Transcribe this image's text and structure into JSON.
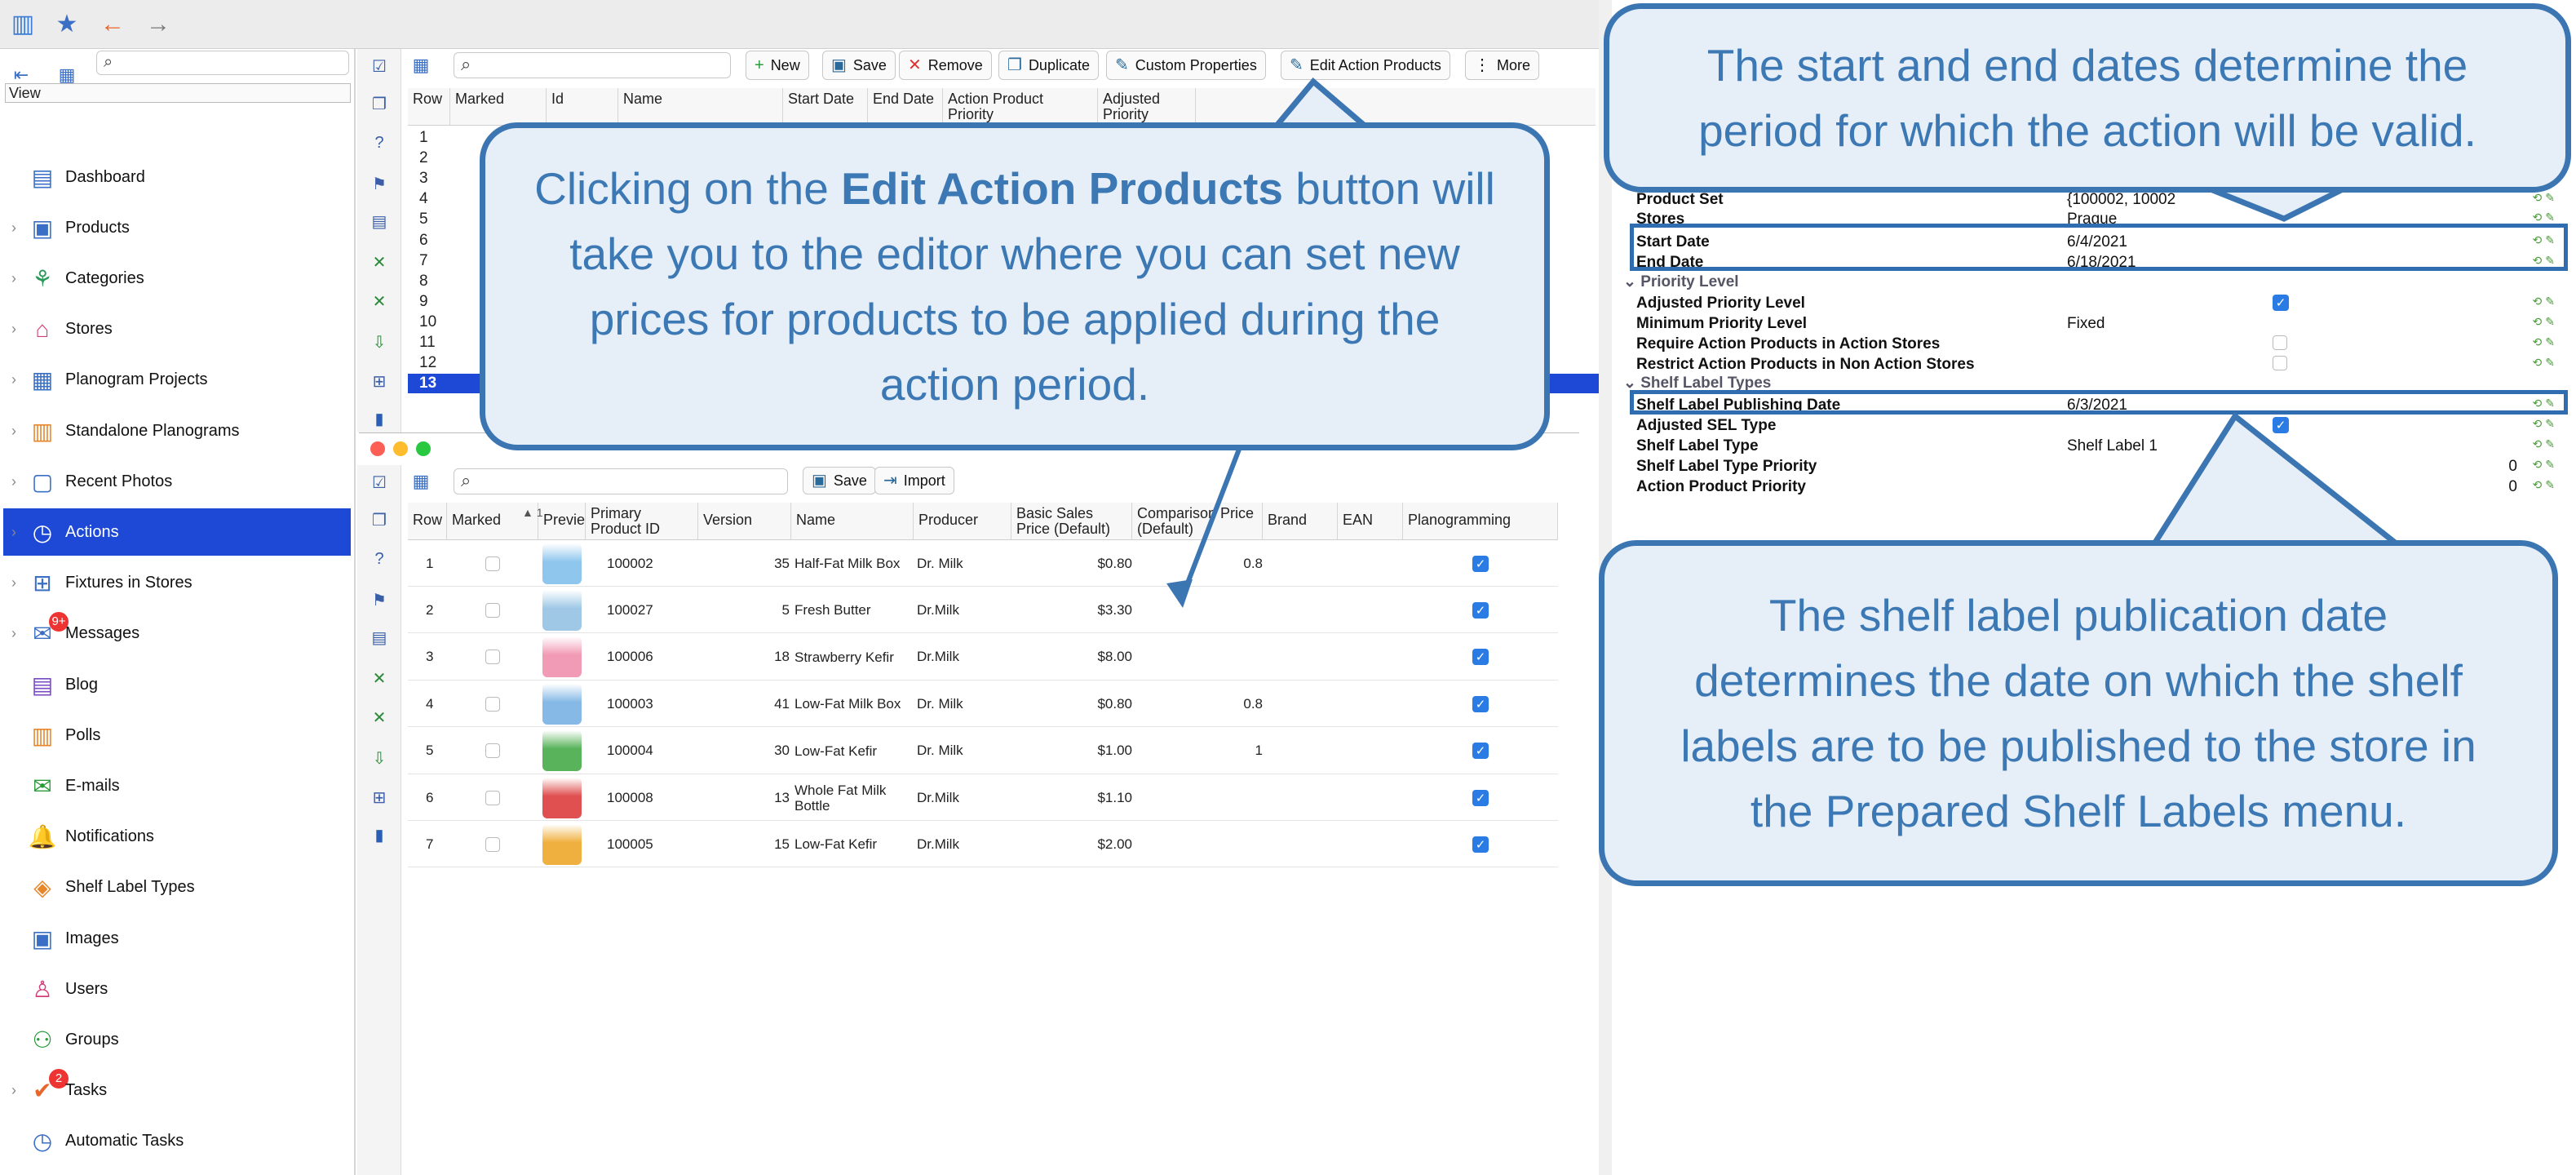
{
  "nav": {
    "view_label": "View",
    "items": [
      {
        "label": "Dashboard",
        "icon": "dashboard-icon"
      },
      {
        "label": "Products",
        "icon": "products-icon"
      },
      {
        "label": "Categories",
        "icon": "categories-icon"
      },
      {
        "label": "Stores",
        "icon": "stores-icon"
      },
      {
        "label": "Planogram Projects",
        "icon": "planogram-projects-icon"
      },
      {
        "label": "Standalone Planograms",
        "icon": "standalone-planograms-icon"
      },
      {
        "label": "Recent Photos",
        "icon": "recent-photos-icon"
      },
      {
        "label": "Actions",
        "icon": "actions-icon"
      },
      {
        "label": "Fixtures in Stores",
        "icon": "fixtures-icon"
      },
      {
        "label": "Messages",
        "icon": "messages-icon",
        "badge": "9+"
      },
      {
        "label": "Blog",
        "icon": "blog-icon"
      },
      {
        "label": "Polls",
        "icon": "polls-icon"
      },
      {
        "label": "E-mails",
        "icon": "email-icon"
      },
      {
        "label": "Notifications",
        "icon": "notifications-icon"
      },
      {
        "label": "Shelf Label Types",
        "icon": "shelf-label-types-icon"
      },
      {
        "label": "Images",
        "icon": "images-icon"
      },
      {
        "label": "Users",
        "icon": "users-icon"
      },
      {
        "label": "Groups",
        "icon": "groups-icon"
      },
      {
        "label": "Tasks",
        "icon": "tasks-icon",
        "badge": "2"
      },
      {
        "label": "Automatic Tasks",
        "icon": "automatic-tasks-icon"
      }
    ]
  },
  "toolbar": {
    "new": "New",
    "save": "Save",
    "remove": "Remove",
    "duplicate": "Duplicate",
    "custom_properties": "Custom Properties",
    "edit_action_products": "Edit Action Products",
    "more": "More"
  },
  "actions_grid": {
    "headers": [
      "Row",
      "Marked",
      "Id",
      "Name",
      "Start Date",
      "End Date",
      "Action Product Priority",
      "Adjusted Priority"
    ],
    "rows": [
      "1",
      "2",
      "3",
      "4",
      "5",
      "6",
      "7",
      "8",
      "9",
      "10",
      "11",
      "12",
      "13"
    ]
  },
  "products_window": {
    "save": "Save",
    "import": "Import",
    "sort_indicator": "1",
    "headers": [
      "Row",
      "Marked",
      "Preview",
      "Primary Product ID",
      "Version",
      "Name",
      "Producer",
      "Basic Sales Price (Default)",
      "Comparison Price (Default)",
      "Brand",
      "EAN",
      "Planogramming"
    ],
    "rows": [
      {
        "row": "1",
        "id": "100002",
        "version": "35",
        "name": "Half-Fat Milk Box",
        "producer": "Dr. Milk",
        "price": "$0.80",
        "comparison": "0.8",
        "planogramming": true,
        "color": "#8fc6ee"
      },
      {
        "row": "2",
        "id": "100027",
        "version": "5",
        "name": "Fresh Butter",
        "producer": "Dr.Milk",
        "price": "$3.30",
        "comparison": "",
        "planogramming": true,
        "color": "#9fc8e6"
      },
      {
        "row": "3",
        "id": "100006",
        "version": "18",
        "name": "Strawberry Kefir",
        "producer": "Dr.Milk",
        "price": "$8.00",
        "comparison": "",
        "planogramming": true,
        "color": "#f29bb6"
      },
      {
        "row": "4",
        "id": "100003",
        "version": "41",
        "name": "Low-Fat Milk Box",
        "producer": "Dr. Milk",
        "price": "$0.80",
        "comparison": "0.8",
        "planogramming": true,
        "color": "#86b9e6"
      },
      {
        "row": "5",
        "id": "100004",
        "version": "30",
        "name": "Low-Fat Kefir",
        "producer": "Dr. Milk",
        "price": "$1.00",
        "comparison": "1",
        "planogramming": true,
        "color": "#58b35a"
      },
      {
        "row": "6",
        "id": "100008",
        "version": "13",
        "name": "Whole Fat Milk Bottle",
        "producer": "Dr.Milk",
        "price": "$1.10",
        "comparison": "",
        "planogramming": true,
        "color": "#e05050"
      },
      {
        "row": "7",
        "id": "100005",
        "version": "15",
        "name": "Low-Fat Kefir",
        "producer": "Dr.Milk",
        "price": "$2.00",
        "comparison": "",
        "planogramming": true,
        "color": "#f0b040"
      }
    ]
  },
  "properties": {
    "product_set": {
      "label": "Product Set",
      "value": "{100002, 10002"
    },
    "stores": {
      "label": "Stores",
      "value": "Prague"
    },
    "start_date": {
      "label": "Start Date",
      "value": "6/4/2021"
    },
    "end_date": {
      "label": "End Date",
      "value": "6/18/2021"
    },
    "priority_section": "Priority Level",
    "adjusted_priority_level": {
      "label": "Adjusted Priority Level",
      "checked": true
    },
    "minimum_priority_level": {
      "label": "Minimum Priority Level",
      "value": "Fixed"
    },
    "require_action_products": {
      "label": "Require Action Products in Action Stores",
      "checked": false
    },
    "restrict_action_products": {
      "label": "Restrict Action Products in Non Action Stores",
      "checked": false
    },
    "shelf_section": "Shelf Label Types",
    "shelf_label_publishing_date": {
      "label": "Shelf Label Publishing Date",
      "value": "6/3/2021"
    },
    "adjusted_sel_type": {
      "label": "Adjusted SEL Type",
      "checked": true
    },
    "shelf_label_type": {
      "label": "Shelf Label Type",
      "value": "Shelf Label 1"
    },
    "shelf_label_type_priority": {
      "label": "Shelf Label Type Priority",
      "value": "0"
    },
    "action_product_priority": {
      "label": "Action Product Priority",
      "value": "0"
    }
  },
  "callouts": {
    "edit_pre": "Clicking on the ",
    "edit_bold": "Edit Action Products",
    "edit_post": " button will take you to the editor where you can set new prices for products to be applied during the action period.",
    "dates": "The start and end dates determine the period for which the action will be valid.",
    "shelf": "The shelf label publication date determines the date on which the shelf labels are to be published to the store in the Prepared Shelf Labels menu."
  },
  "colors": {
    "accent": "#1e49d6",
    "callout_border": "#3b76b3",
    "callout_fill": "#e6eef7",
    "callout_text": "#3b78b4"
  }
}
